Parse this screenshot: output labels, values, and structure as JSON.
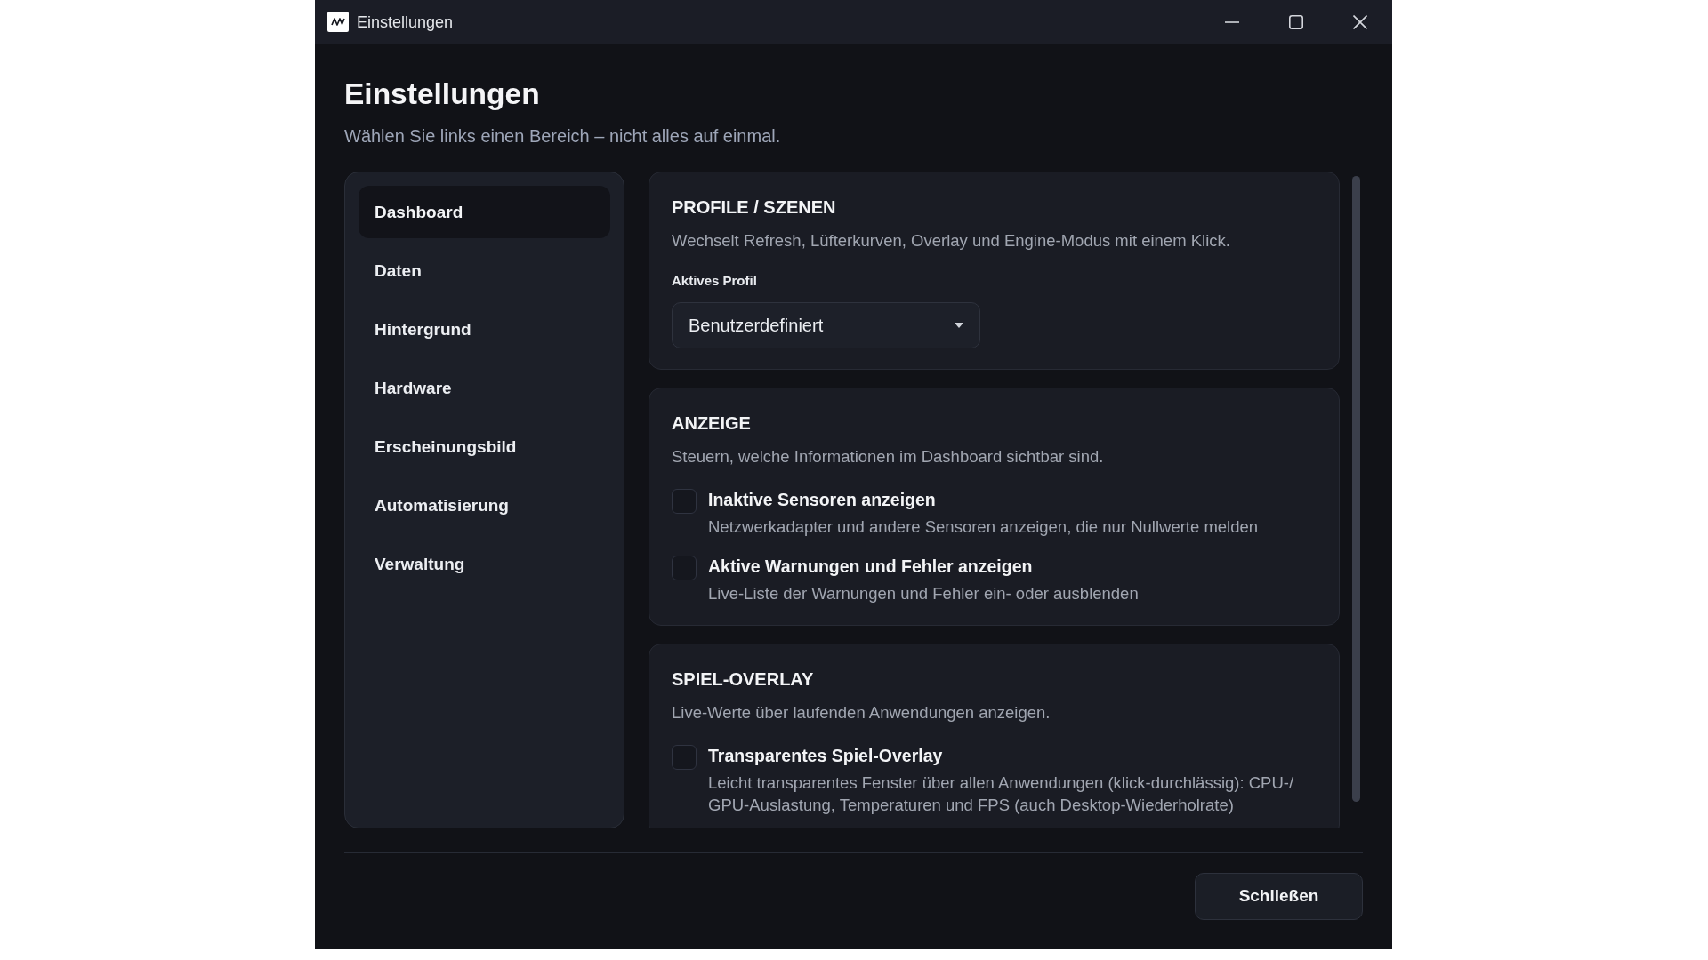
{
  "window": {
    "title": "Einstellungen"
  },
  "page": {
    "title": "Einstellungen",
    "subtitle": "Wählen Sie links einen Bereich – nicht alles auf einmal."
  },
  "sidebar": {
    "items": [
      {
        "label": "Dashboard",
        "selected": true
      },
      {
        "label": "Daten",
        "selected": false
      },
      {
        "label": "Hintergrund",
        "selected": false
      },
      {
        "label": "Hardware",
        "selected": false
      },
      {
        "label": "Erscheinungsbild",
        "selected": false
      },
      {
        "label": "Automatisierung",
        "selected": false
      },
      {
        "label": "Verwaltung",
        "selected": false
      }
    ]
  },
  "sections": [
    {
      "title": "PROFILE / SZENEN",
      "description": "Wechselt Refresh, Lüfterkurven, Overlay und Engine-Modus mit einem Klick.",
      "items": [
        {
          "kind": "select",
          "label": "Aktives Profil",
          "value": "Benutzerdefiniert"
        }
      ]
    },
    {
      "title": "ANZEIGE",
      "description": "Steuern, welche Informationen im Dashboard sichtbar sind.",
      "items": [
        {
          "kind": "checkbox",
          "label": "Inaktive Sensoren anzeigen",
          "description": "Netzwerkadapter und andere Sensoren anzeigen, die nur Nullwerte melden",
          "checked": false
        },
        {
          "kind": "checkbox",
          "label": "Aktive Warnungen und Fehler anzeigen",
          "description": "Live-Liste der Warnungen und Fehler ein- oder ausblenden",
          "checked": false
        }
      ]
    },
    {
      "title": "SPIEL-OVERLAY",
      "description": "Live-Werte über laufenden Anwendungen anzeigen.",
      "items": [
        {
          "kind": "checkbox",
          "label": "Transparentes Spiel-Overlay",
          "description": "Leicht transparentes Fenster über allen Anwendungen (klick-durchlässig): CPU-/GPU-Auslastung, Temperaturen und FPS (auch Desktop-Wiederholrate)",
          "checked": false
        }
      ]
    }
  ],
  "footer": {
    "buttons": [
      "Schließen"
    ]
  }
}
